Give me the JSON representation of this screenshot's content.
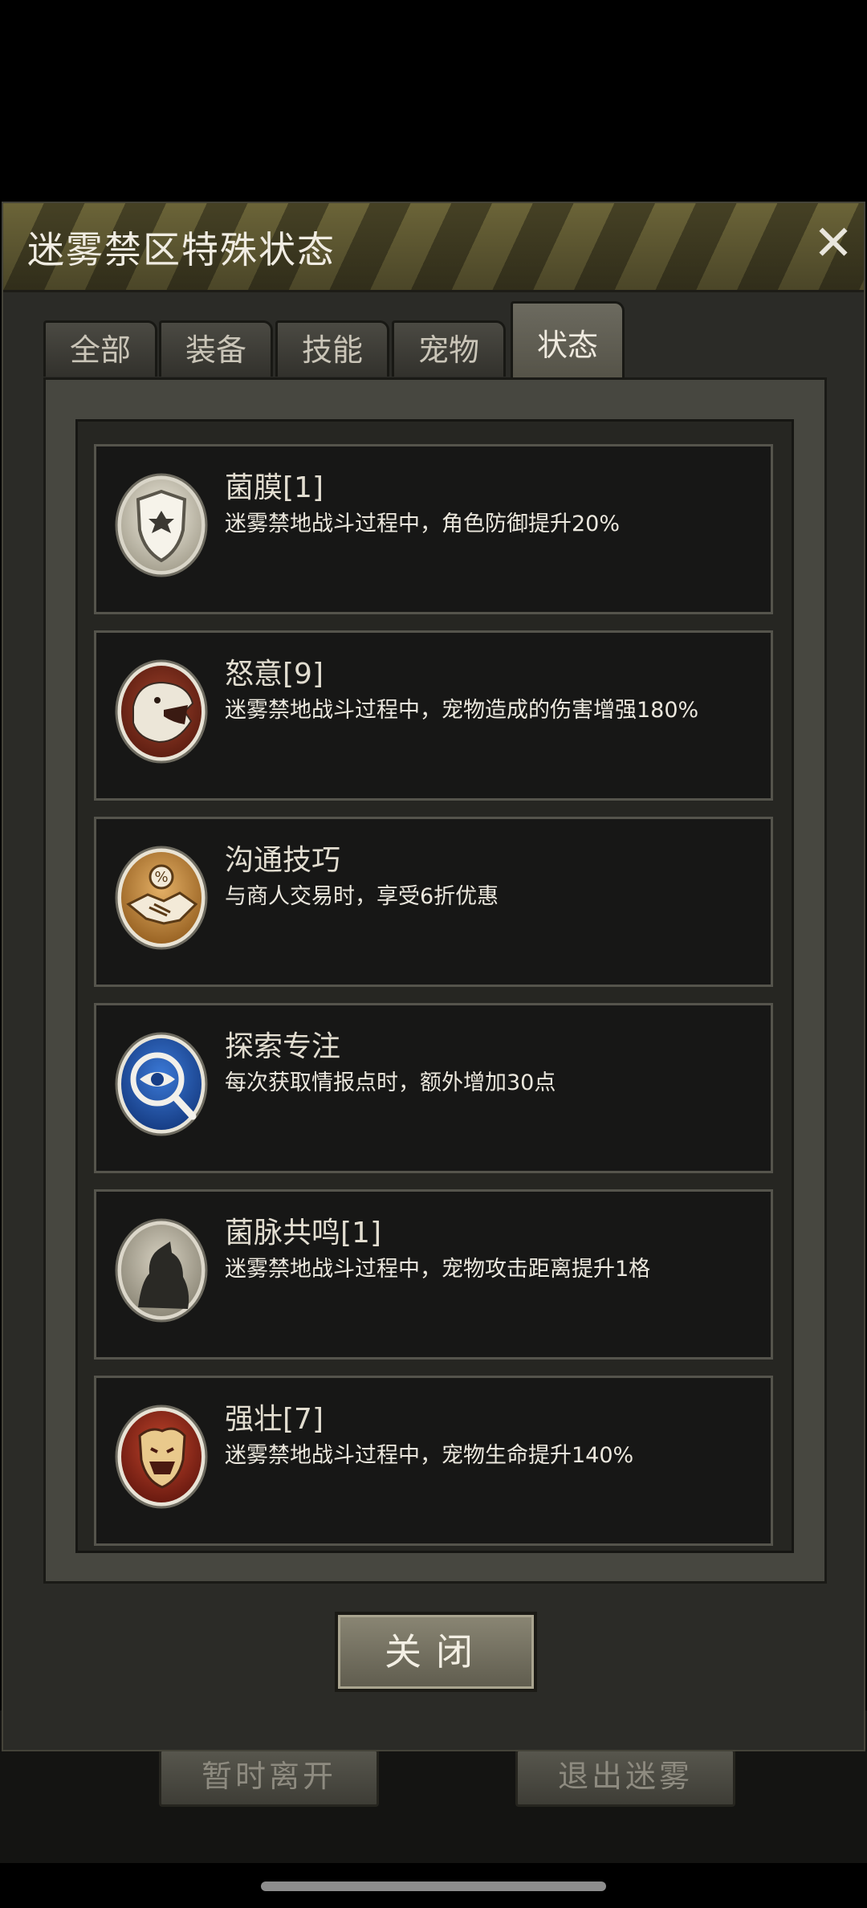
{
  "dialog": {
    "title": "迷雾禁区特殊状态",
    "close_icon": "close-icon",
    "close_button": "关闭"
  },
  "tabs": [
    {
      "label": "全部",
      "active": false
    },
    {
      "label": "装备",
      "active": false
    },
    {
      "label": "技能",
      "active": false
    },
    {
      "label": "宠物",
      "active": false
    },
    {
      "label": "状态",
      "active": true
    }
  ],
  "statuses": [
    {
      "name": "菌膜[1]",
      "desc": "迷雾禁地战斗过程中，角色防御提升20%",
      "icon": "shield-icon"
    },
    {
      "name": "怒意[9]",
      "desc": "迷雾禁地战斗过程中，宠物造成的伤害增强180%",
      "icon": "roaring-beast-icon"
    },
    {
      "name": "沟通技巧",
      "desc": "与商人交易时，享受6折优惠",
      "icon": "handshake-discount-icon"
    },
    {
      "name": "探索专注",
      "desc": "每次获取情报点时，额外增加30点",
      "icon": "eye-magnifier-icon"
    },
    {
      "name": "菌脉共鸣[1]",
      "desc": "迷雾禁地战斗过程中，宠物攻击距离提升1格",
      "icon": "beast-silhouette-icon"
    },
    {
      "name": "强壮[7]",
      "desc": "迷雾禁地战斗过程中，宠物生命提升140%",
      "icon": "snarling-beast-icon"
    }
  ],
  "background_buttons": [
    "暂时离开",
    "退出迷雾"
  ],
  "colors": {
    "header": "#5a5430",
    "panel": "#474740",
    "card": "#171716"
  }
}
